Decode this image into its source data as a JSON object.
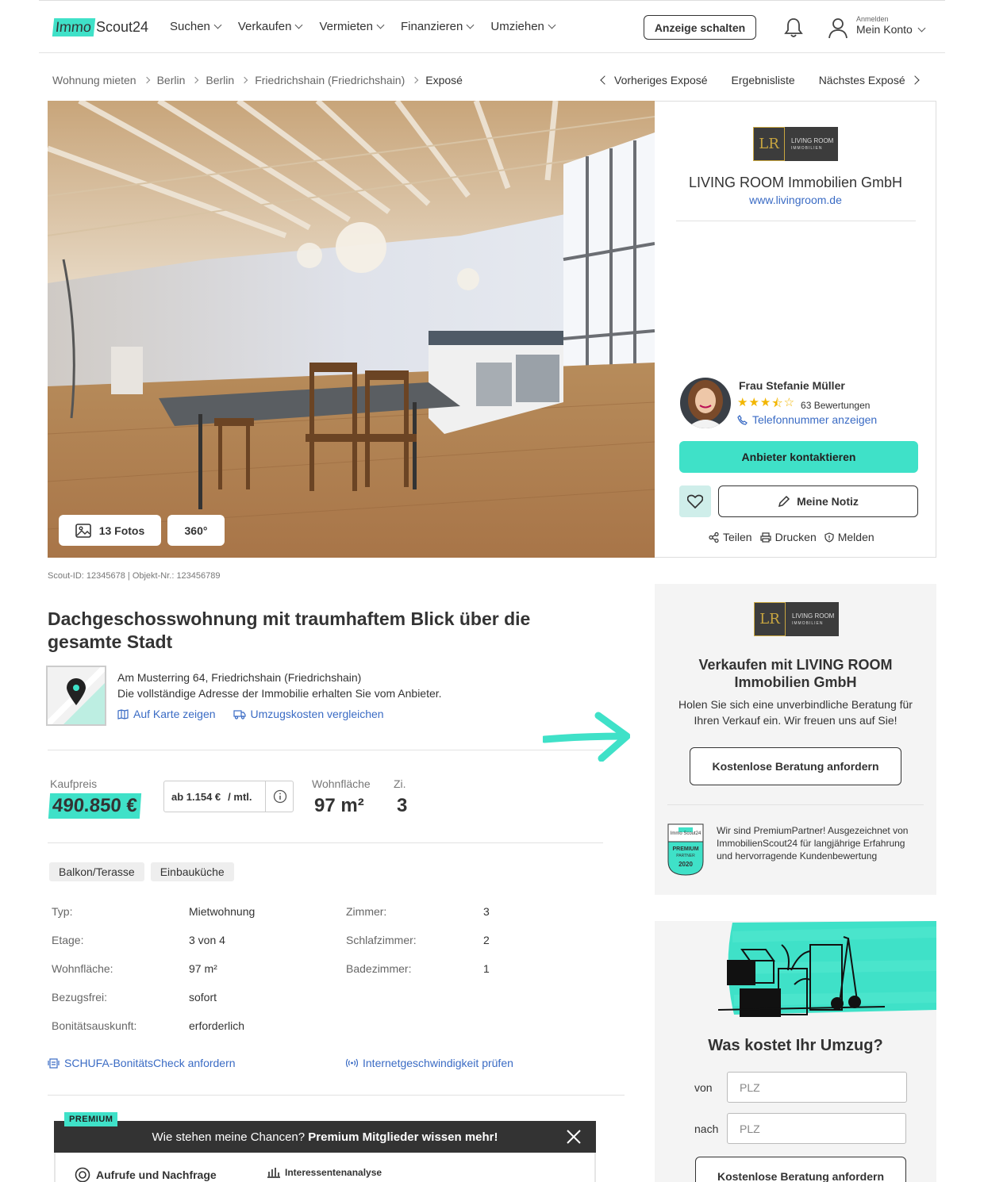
{
  "brand": {
    "logo_left": "Immo",
    "logo_right": "Scout24",
    "accent": "#3fe1c8",
    "link_color": "#3a6bc4"
  },
  "nav": {
    "items": [
      "Suchen",
      "Verkaufen",
      "Vermieten",
      "Finanzieren",
      "Umziehen"
    ]
  },
  "header": {
    "cta": "Anzeige schalten",
    "login_small": "Anmelden",
    "account": "Mein Konto"
  },
  "breadcrumb": {
    "items": [
      "Wohnung mieten",
      "Berlin",
      "Berlin",
      "Friedrichshain (Friedrichshain)"
    ],
    "current": "Exposé"
  },
  "pager": {
    "prev": "Vorheriges Exposé",
    "list": "Ergebnisliste",
    "next": "Nächstes Exposé"
  },
  "gallery": {
    "photos": "13 Fotos",
    "tour": "360°"
  },
  "agent": {
    "logo_mono": "LR",
    "logo_line1": "LIVING ROOM",
    "logo_line2": "IMMOBILIEN",
    "company": "LIVING ROOM Immobilien GmbH",
    "website": "www.livingroom.de",
    "person": "Frau Stefanie Müller",
    "rating": 3.5,
    "reviews": "63 Bewertungen",
    "phone": "Telefonnummer anzeigen",
    "contact": "Anbieter kontaktieren",
    "note": "Meine Notiz",
    "share": "Teilen",
    "print": "Drucken",
    "report": "Melden"
  },
  "listing": {
    "meta": "Scout-ID: 12345678 | Objekt-Nr.: 123456789",
    "title": "Dachgeschosswohnung mit traumhaftem Blick über die gesamte Stadt",
    "address": "Am Musterring 64, Friedrichshain (Friedrichshain)",
    "address_note": "Die vollständige Adresse der Immobilie erhalten Sie vom Anbieter.",
    "map_link": "Auf Karte zeigen",
    "moving_link": "Umzugskosten vergleichen",
    "price_label": "Kaufpreis",
    "price": "490.850 €",
    "monthly_from": "ab 1.154 €",
    "monthly_unit": "/ mtl.",
    "area_label": "Wohnfläche",
    "area": "97 m²",
    "rooms_label": "Zi.",
    "rooms": "3",
    "tags": [
      "Balkon/Terasse",
      "Einbauküche"
    ],
    "attrs_left": [
      {
        "k": "Typ:",
        "v": "Mietwohnung"
      },
      {
        "k": "Etage:",
        "v": "3 von 4"
      },
      {
        "k": "Wohnfläche:",
        "v": "97 m²"
      },
      {
        "k": "Bezugsfrei:",
        "v": "sofort"
      },
      {
        "k": "Bonitätsauskunft:",
        "v": "erforderlich"
      }
    ],
    "attrs_right": [
      {
        "k": "Zimmer:",
        "v": "3"
      },
      {
        "k": "Schlafzimmer:",
        "v": "2"
      },
      {
        "k": "Badezimmer:",
        "v": "1"
      }
    ],
    "schufa": "SCHUFA-BonitätsCheck anfordern",
    "internet": "Internetgeschwindigkeit prüfen"
  },
  "sell": {
    "title": "Verkaufen mit LIVING ROOM Immobilien GmbH",
    "text": "Holen Sie sich eine unverbindliche Beratung für Ihren Verkauf ein. Wir freuen uns auf Sie!",
    "cta": "Kostenlose Beratung anfordern",
    "badge_top": "Immo Scout24",
    "badge_mid": "PREMIUM",
    "badge_sub": "PARTNER",
    "badge_year": "2020",
    "partner_text": "Wir sind PremiumPartner! Ausgezeichnet von ImmobilienScout24 für langjährige Erfahrung und hervorragende Kundenbewertung"
  },
  "move": {
    "title": "Was kostet Ihr Umzug?",
    "from_label": "von",
    "to_label": "nach",
    "placeholder": "PLZ",
    "cta": "Kostenlose Beratung anfordern"
  },
  "premium": {
    "tag": "PREMIUM",
    "text_normal": "Wie stehen meine Chancen? ",
    "text_bold": "Premium Mitglieder wissen mehr!",
    "tab1": "Aufrufe und Nachfrage",
    "tab2": "Interessentenanalyse"
  }
}
